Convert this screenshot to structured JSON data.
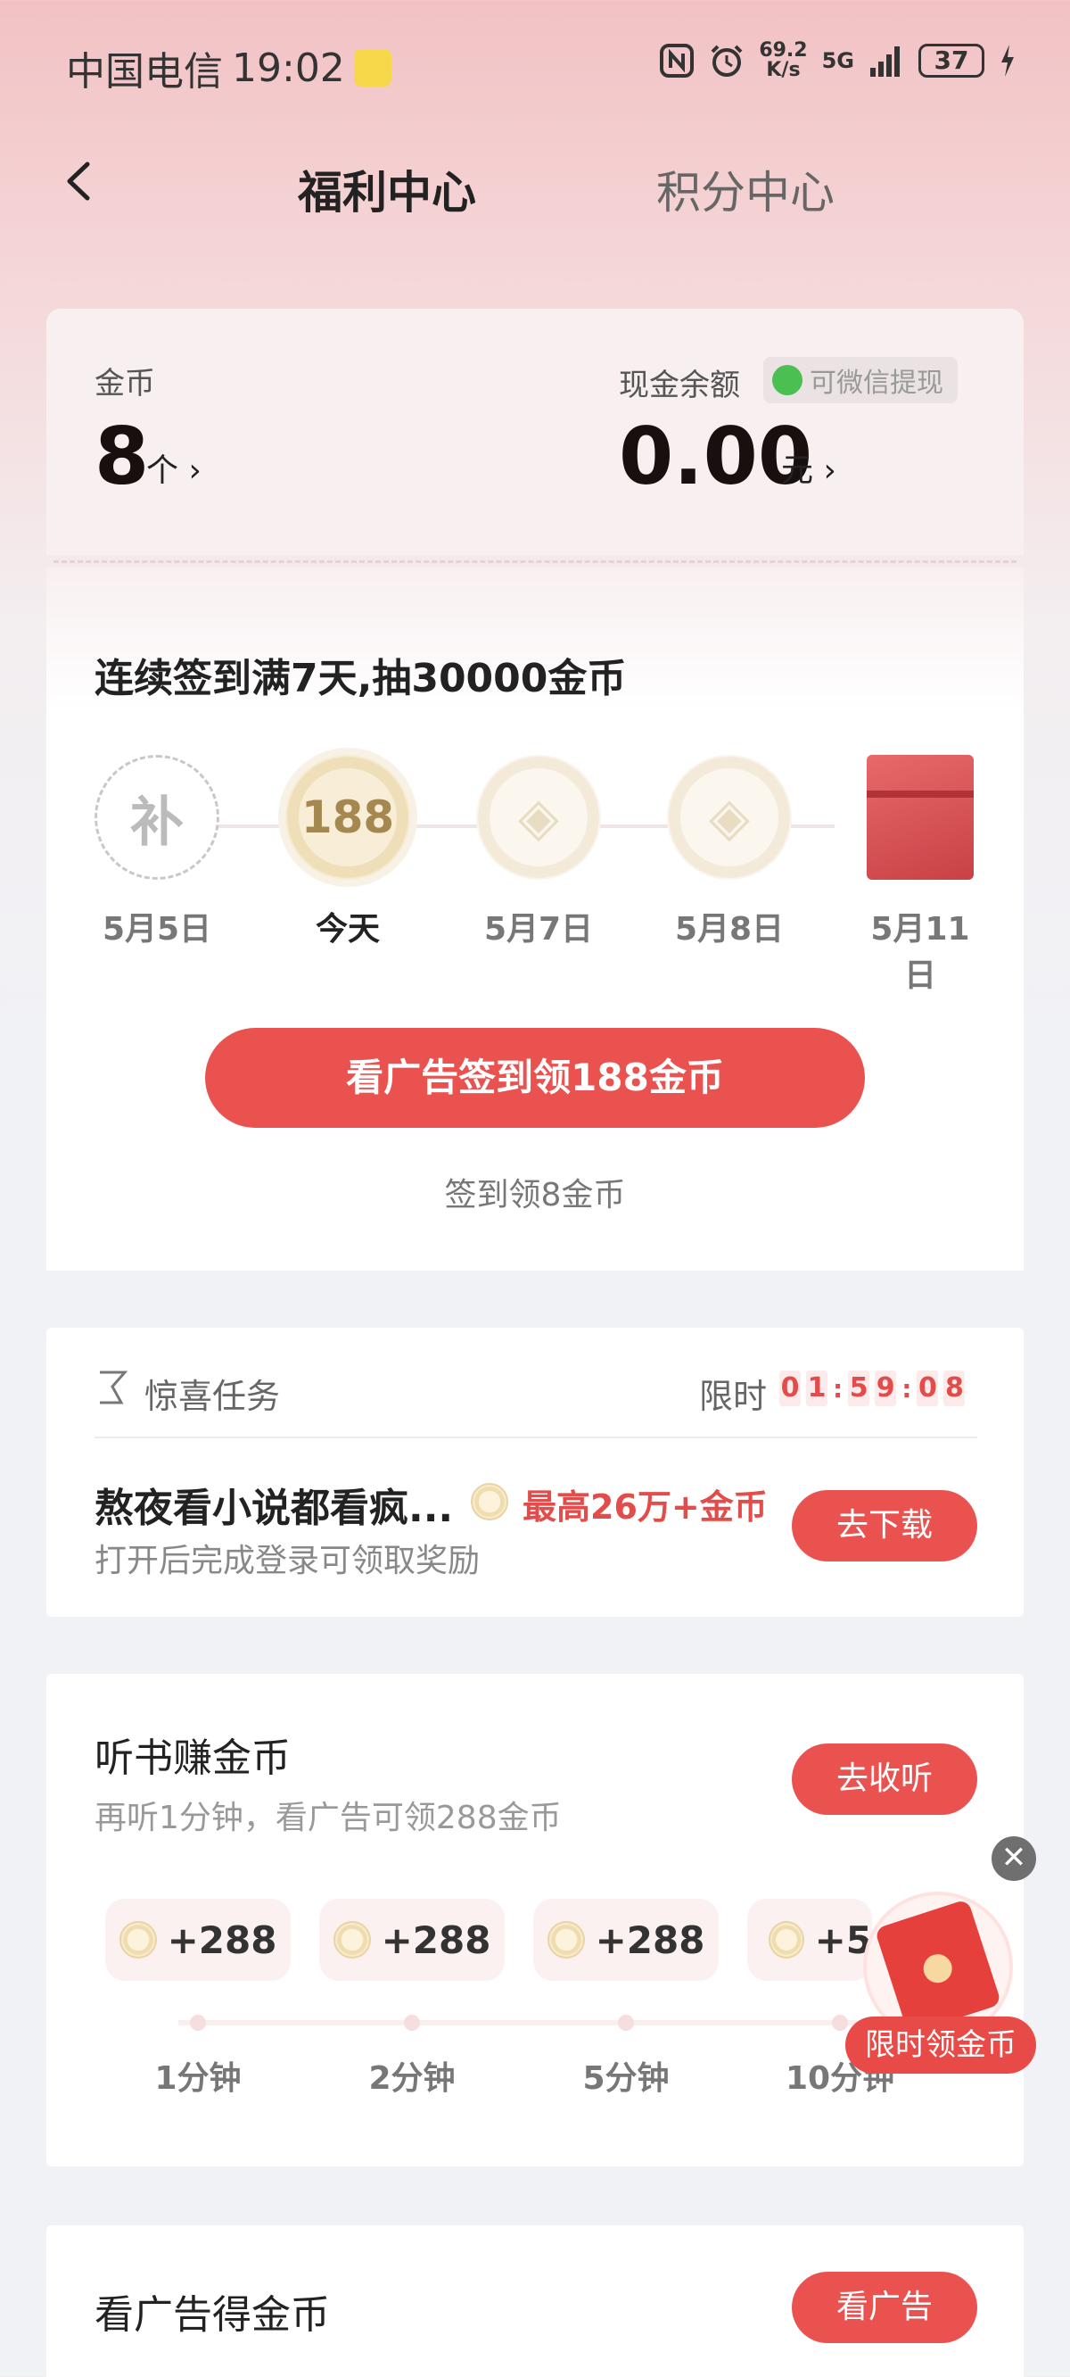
{
  "status_bar": {
    "carrier": "中国电信",
    "time": "19:02",
    "net_speed_value": "69.2",
    "net_speed_unit": "K/s",
    "network": "5G",
    "battery": "37"
  },
  "header": {
    "tab_active": "福利中心",
    "tab_inactive": "积分中心"
  },
  "balance": {
    "gold_label": "金币",
    "gold_value": "8",
    "gold_unit": "个",
    "cash_label": "现金余额",
    "wechat_badge": "可微信提现",
    "cash_value": "0.00",
    "cash_unit": "元"
  },
  "checkin": {
    "title": "连续签到满7天,抽30000金币",
    "days": [
      {
        "coin_text": "补",
        "label": "5月5日"
      },
      {
        "coin_text": "188",
        "label": "今天"
      },
      {
        "coin_text": "◈",
        "label": "5月7日"
      },
      {
        "coin_text": "◈",
        "label": "5月8日"
      },
      {
        "coin_text": "",
        "label": "5月11日"
      }
    ],
    "primary_button": "看广告签到领188金币",
    "secondary_link": "签到领8金币"
  },
  "surprise_task": {
    "title": "惊喜任务",
    "limit_label": "限时",
    "timer": [
      "0",
      "1",
      "5",
      "9",
      "0",
      "8"
    ],
    "task_title": "熬夜看小说都看疯...",
    "task_reward": "最高26万+金币",
    "task_desc": "打开后完成登录可领取奖励",
    "button": "去下载"
  },
  "listen": {
    "title": "听书赚金币",
    "subtitle": "再听1分钟，看广告可领288金币",
    "button": "去收听",
    "rewards": [
      "+288",
      "+288",
      "+288",
      "+5"
    ],
    "minutes": [
      "1分钟",
      "2分钟",
      "5分钟",
      "10分钟"
    ]
  },
  "floating": {
    "close": "✕",
    "label": "限时领金币"
  },
  "ad": {
    "title": "看广告得金币",
    "button": "看广告"
  },
  "colors": {
    "accent": "#ea5250",
    "reward_text": "#e24c4a",
    "wechat_green": "#4cbf52"
  }
}
